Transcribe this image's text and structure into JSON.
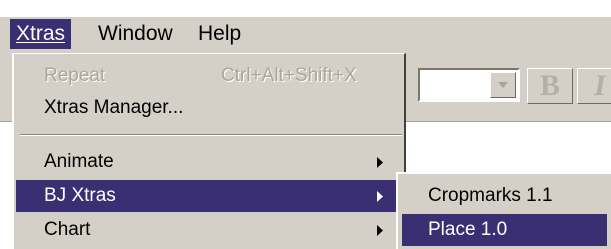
{
  "menubar": {
    "menus": [
      {
        "label": "Xtras",
        "state": "open"
      },
      {
        "label": "Window"
      },
      {
        "label": "Help"
      }
    ]
  },
  "toolbar": {
    "bold_label": "B",
    "italic_label": "I"
  },
  "xtras_menu": {
    "items": [
      {
        "label": "Repeat",
        "shortcut": "Ctrl+Alt+Shift+X",
        "enabled": false
      },
      {
        "label": "Xtras Manager..."
      },
      {
        "label": "Animate",
        "submenu": true
      },
      {
        "label": "BJ Xtras",
        "submenu": true,
        "highlighted": true
      },
      {
        "label": "Chart",
        "submenu": true
      }
    ]
  },
  "bj_xtras_submenu": {
    "items": [
      {
        "label": "Cropmarks 1.1"
      },
      {
        "label": "Place 1.0",
        "highlighted": true
      }
    ]
  },
  "colors": {
    "menu_face": "#d4d0c8",
    "highlight": "#3b2f73"
  },
  "icons": [
    "chevron-down-icon",
    "submenu-arrow-icon"
  ]
}
